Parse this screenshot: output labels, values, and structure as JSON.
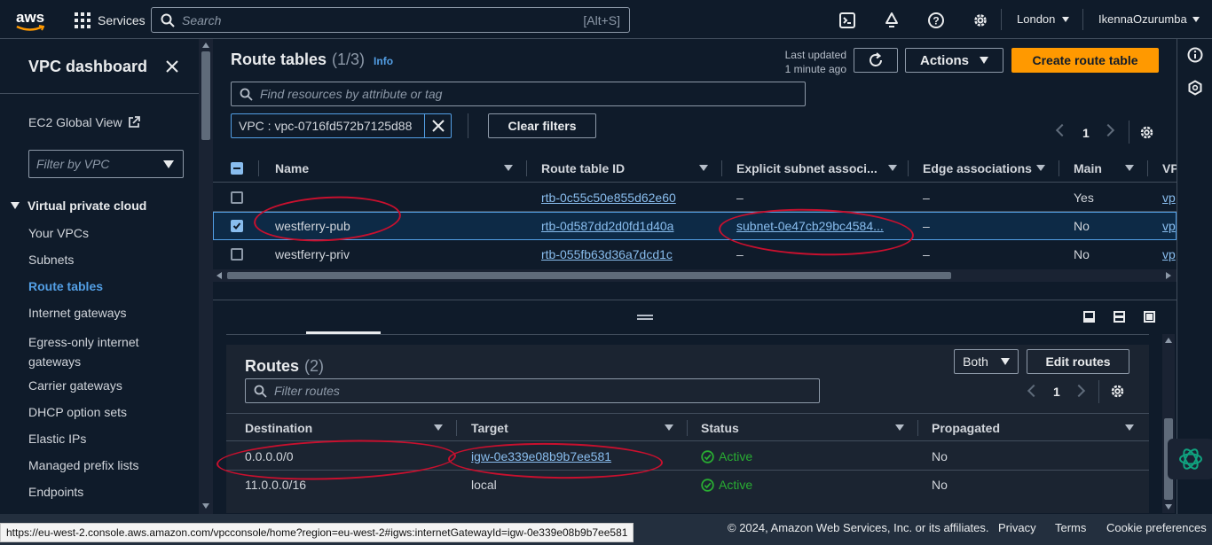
{
  "topbar": {
    "logo": "aws",
    "services_label": "Services",
    "search_placeholder": "Search",
    "search_shortcut": "[Alt+S]",
    "region": "London",
    "user": "IkennaOzurumba"
  },
  "sidebar": {
    "title": "VPC dashboard",
    "ec2_global_view": "EC2 Global View",
    "filter_placeholder": "Filter by VPC",
    "section": "Virtual private cloud",
    "items": [
      "Your VPCs",
      "Subnets",
      "Route tables",
      "Internet gateways",
      "Egress-only internet gateways",
      "Carrier gateways",
      "DHCP option sets",
      "Elastic IPs",
      "Managed prefix lists",
      "Endpoints"
    ],
    "active_item": "Route tables"
  },
  "route_tables": {
    "title": "Route tables",
    "count": "(1/3)",
    "info": "Info",
    "last_updated_line1": "Last updated",
    "last_updated_line2": "1 minute ago",
    "actions_label": "Actions",
    "create_label": "Create route table",
    "search_placeholder": "Find resources by attribute or tag",
    "filter_chip": "VPC : vpc-0716fd572b7125d88",
    "clear_filters": "Clear filters",
    "page": "1",
    "columns": [
      "Name",
      "Route table ID",
      "Explicit subnet associ...",
      "Edge associations",
      "Main",
      "VP"
    ],
    "rows": [
      {
        "name": "",
        "id": "rtb-0c55c50e855d62e60",
        "subnet": "–",
        "edge": "–",
        "main": "Yes",
        "vpc": "vp",
        "selected": false
      },
      {
        "name": "westferry-pub",
        "id": "rtb-0d587dd2d0fd1d40a",
        "subnet": "subnet-0e47cb29bc4584...",
        "edge": "–",
        "main": "No",
        "vpc": "vp",
        "selected": true
      },
      {
        "name": "westferry-priv",
        "id": "rtb-055fb63d36a7dcd1c",
        "subnet": "–",
        "edge": "–",
        "main": "No",
        "vpc": "vp",
        "selected": false
      }
    ]
  },
  "routes": {
    "title": "Routes",
    "count": "(2)",
    "both_label": "Both",
    "edit_label": "Edit routes",
    "filter_placeholder": "Filter routes",
    "page": "1",
    "columns": [
      "Destination",
      "Target",
      "Status",
      "Propagated"
    ],
    "rows": [
      {
        "destination": "0.0.0.0/0",
        "target": "igw-0e339e08b9b7ee581",
        "target_link": true,
        "status": "Active",
        "propagated": "No"
      },
      {
        "destination": "11.0.0.0/16",
        "target": "local",
        "target_link": false,
        "status": "Active",
        "propagated": "No"
      }
    ]
  },
  "footer": {
    "status_url": "https://eu-west-2.console.aws.amazon.com/vpcconsole/home?region=eu-west-2#igws:internetGatewayId=igw-0e339e08b9b7ee581",
    "copyright": "© 2024, Amazon Web Services, Inc. or its affiliates.",
    "privacy": "Privacy",
    "terms": "Terms",
    "cookies": "Cookie preferences"
  },
  "colors": {
    "accent": "#ff9900",
    "link": "#89bdee",
    "active_green": "#29ad32",
    "annotation_red": "#c8102e"
  }
}
